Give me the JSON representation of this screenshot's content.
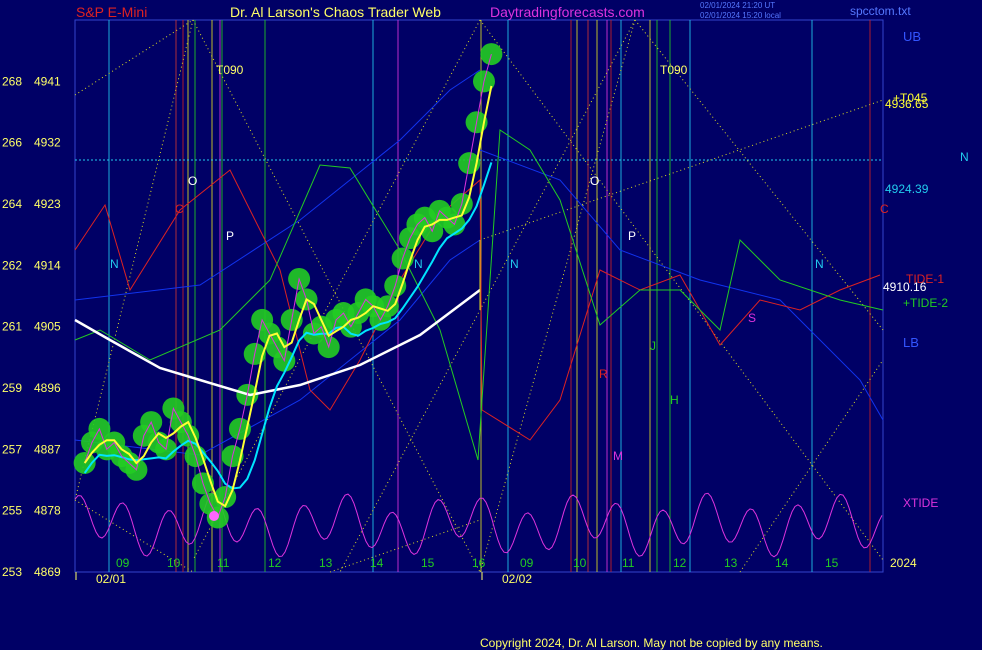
{
  "header": {
    "instrument": "S&P E-Mini",
    "site_title": "Dr. Al Larson's Chaos Trader Web",
    "site_url": "Daytradingforecasts.com",
    "timestamp_1": "02/01/2024 21:20 UT",
    "timestamp_2": "02/01/2024 15:20 local",
    "file_name": "spcctom.txt"
  },
  "footer": {
    "copyright": "Copyright 2024, Dr. Al Larson. May not be copied by any means."
  },
  "colors": {
    "background": "#000066",
    "price_glow": "#22cc22",
    "price_line": "#ffffff",
    "fast_avg": "#ffff33",
    "slow_avg": "#00e5ff",
    "long_avg": "#ffffff",
    "tide1": "#dd2222",
    "tide2": "#22cc22",
    "xtide": "#dd33dd",
    "band": "#1133ee"
  },
  "chart_data": {
    "type": "line",
    "ylim": [
      4869,
      4950
    ],
    "y_ticks": [
      {
        "y": 4869,
        "left": "253",
        "right": "4869"
      },
      {
        "y": 4878,
        "left": "255",
        "right": "4878"
      },
      {
        "y": 4887,
        "left": "257",
        "right": "4887"
      },
      {
        "y": 4896,
        "left": "259",
        "right": "4896"
      },
      {
        "y": 4905,
        "left": "261",
        "right": "4905"
      },
      {
        "y": 4914,
        "left": "262",
        "right": "4914"
      },
      {
        "y": 4923,
        "left": "264",
        "right": "4923"
      },
      {
        "y": 4932,
        "left": "266",
        "right": "4932"
      },
      {
        "y": 4941,
        "left": "268",
        "right": "4941"
      }
    ],
    "x_hour_labels": [
      "09",
      "10",
      "11",
      "12",
      "13",
      "14",
      "15",
      "16",
      "09",
      "10",
      "11",
      "12",
      "13",
      "14",
      "15"
    ],
    "dates": [
      "02/01",
      "02/02"
    ],
    "year_label": "2024",
    "right_labels": {
      "ub": "UB",
      "lb": "LB",
      "tide1": "TIDE-1",
      "tide2": "+TIDE-2",
      "xtide": "XTIDE",
      "t045": "+T045",
      "n": "N"
    },
    "right_values": {
      "level_a": "4936.65",
      "level_b": "4924.39",
      "level_c": "4910.16"
    },
    "price_series": {
      "name": "S&P E-Mini",
      "points": [
        [
          0,
          4885
        ],
        [
          0.1,
          4888
        ],
        [
          0.2,
          4890
        ],
        [
          0.3,
          4887
        ],
        [
          0.4,
          4888
        ],
        [
          0.5,
          4886
        ],
        [
          0.6,
          4885
        ],
        [
          0.7,
          4884
        ],
        [
          0.8,
          4889
        ],
        [
          0.9,
          4891
        ],
        [
          1.0,
          4888
        ],
        [
          1.1,
          4887
        ],
        [
          1.2,
          4893
        ],
        [
          1.3,
          4891
        ],
        [
          1.4,
          4889
        ],
        [
          1.5,
          4886
        ],
        [
          1.6,
          4882
        ],
        [
          1.7,
          4879
        ],
        [
          1.8,
          4877
        ],
        [
          1.9,
          4880
        ],
        [
          2.0,
          4886
        ],
        [
          2.1,
          4890
        ],
        [
          2.2,
          4895
        ],
        [
          2.3,
          4901
        ],
        [
          2.4,
          4906
        ],
        [
          2.5,
          4904
        ],
        [
          2.6,
          4902
        ],
        [
          2.7,
          4900
        ],
        [
          2.8,
          4906
        ],
        [
          2.9,
          4912
        ],
        [
          3.0,
          4909
        ],
        [
          3.1,
          4904
        ],
        [
          3.2,
          4905
        ],
        [
          3.3,
          4902
        ],
        [
          3.4,
          4906
        ],
        [
          3.5,
          4907
        ],
        [
          3.6,
          4905
        ],
        [
          3.7,
          4907
        ],
        [
          3.8,
          4909
        ],
        [
          3.9,
          4908
        ],
        [
          4.0,
          4906
        ],
        [
          4.1,
          4908
        ],
        [
          4.2,
          4911
        ],
        [
          4.3,
          4915
        ],
        [
          4.4,
          4918
        ],
        [
          4.5,
          4920
        ],
        [
          4.6,
          4921
        ],
        [
          4.7,
          4919
        ],
        [
          4.8,
          4922
        ],
        [
          4.9,
          4921
        ],
        [
          5.0,
          4920
        ],
        [
          5.1,
          4923
        ],
        [
          5.2,
          4929
        ],
        [
          5.3,
          4935
        ],
        [
          5.4,
          4941
        ],
        [
          5.5,
          4945
        ]
      ]
    },
    "tide1_series": {
      "name": "TIDE-1"
    },
    "tide2_series": {
      "name": "+TIDE-2"
    },
    "xtide_series": {
      "name": "XTIDE"
    },
    "markers": [
      "O",
      "P",
      "N",
      "C",
      "T090",
      "R",
      "M",
      "H",
      "J",
      "S"
    ]
  }
}
